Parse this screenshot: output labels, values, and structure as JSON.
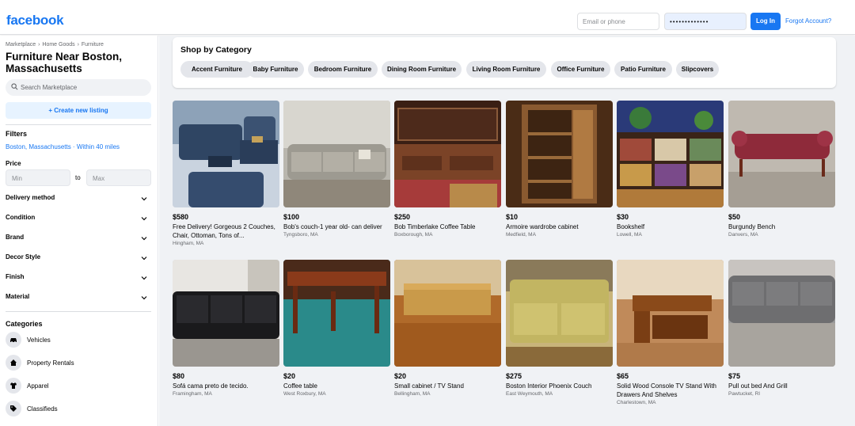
{
  "header": {
    "logo": "facebook",
    "email_placeholder": "Email or phone",
    "password_value": "•••••••••••••",
    "login_label": "Log In",
    "forgot_label": "Forgot Account?"
  },
  "sidebar": {
    "breadcrumb": [
      "Marketplace",
      "›",
      "Home Goods",
      "›",
      "Furniture"
    ],
    "title": "Furniture Near Boston, Massachusetts",
    "search_placeholder": "Search Marketplace",
    "create_label": "+ Create new listing",
    "filters_heading": "Filters",
    "location": "Boston, Massachusetts · Within 40 miles",
    "price_heading": "Price",
    "min_placeholder": "Min",
    "to_label": "to",
    "max_placeholder": "Max",
    "filter_rows": [
      "Delivery method",
      "Condition",
      "Brand",
      "Decor Style",
      "Finish",
      "Material"
    ],
    "categories_heading": "Categories",
    "categories": [
      {
        "label": "Vehicles",
        "icon": "car-icon"
      },
      {
        "label": "Property Rentals",
        "icon": "house-icon"
      },
      {
        "label": "Apparel",
        "icon": "shirt-icon"
      },
      {
        "label": "Classifieds",
        "icon": "tag-icon"
      }
    ]
  },
  "shop": {
    "heading": "Shop by Category",
    "chips": [
      "Accent Furniture",
      "Baby Furniture",
      "Bedroom Furniture",
      "Dining Room Furniture",
      "Living Room Furniture",
      "Office Furniture",
      "Patio Furniture",
      "Slipcovers"
    ]
  },
  "listings": [
    {
      "price": "$580",
      "title": "Free Delivery! Gorgeous 2 Couches, Chair, Ottoman, Tons of...",
      "location": "Hingham, MA"
    },
    {
      "price": "$100",
      "title": "Bob's couch-1 year old- can deliver",
      "location": "Tyngsboro, MA"
    },
    {
      "price": "$250",
      "title": "Bob Timberlake Coffee Table",
      "location": "Boxborough, MA"
    },
    {
      "price": "$10",
      "title": "Armoire wardrobe cabinet",
      "location": "Medfield, MA"
    },
    {
      "price": "$30",
      "title": "Bookshelf",
      "location": "Lowell, MA"
    },
    {
      "price": "$50",
      "title": "Burgundy Bench",
      "location": "Danvers, MA"
    },
    {
      "price": "$80",
      "title": "Sofá cama preto de tecido.",
      "location": "Framingham, MA"
    },
    {
      "price": "$20",
      "title": "Coffee table",
      "location": "West Roxbury, MA"
    },
    {
      "price": "$20",
      "title": "Small cabinet / TV Stand",
      "location": "Bellingham, MA"
    },
    {
      "price": "$275",
      "title": "Boston Interior Phoenix Couch",
      "location": "East Weymouth, MA"
    },
    {
      "price": "$65",
      "title": "Solid Wood Console TV Stand With Drawers And Shelves",
      "location": "Charlestown, MA"
    },
    {
      "price": "$75",
      "title": "Pull out bed And Grill",
      "location": "Pawtucket, RI"
    }
  ],
  "colors": {
    "brand": "#1877f2",
    "background": "#f0f2f5"
  }
}
